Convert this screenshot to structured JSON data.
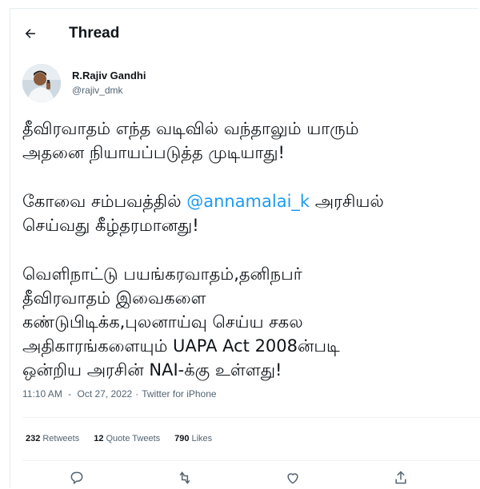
{
  "header": {
    "title": "Thread"
  },
  "tweet": {
    "author": {
      "name": "R.Rajiv Gandhi",
      "handle": "@rajiv_dmk"
    },
    "paragraphs": [
      {
        "lines": [
          {
            "text": "தீவிரவாதம் எந்த வடிவில் வந்தாலும் யாரும்"
          },
          {
            "text": "அதனை நியாயப்படுத்த முடியாது!"
          }
        ]
      },
      {
        "lines": [
          {
            "pre": "கோவை சம்பவத்தில் ",
            "mention": "@annamalai_k",
            "post": " அரசியல்"
          },
          {
            "text": "செய்வது கீழ்தரமானது!"
          }
        ]
      },
      {
        "lines": [
          {
            "text": "வெளிநாட்டு பயங்கரவாதம்,தனிநபர்"
          },
          {
            "text": "தீவிரவாதம் இவைகளை"
          },
          {
            "text": "கண்டுபிடிக்க,புலனாய்வு செய்ய சகல"
          },
          {
            "text": "அதிகாரங்களையும் UAPA Act 2008ன்படி"
          },
          {
            "text": "ஒன்றிய அரசின் NAI-க்கு உள்ளது!"
          }
        ]
      }
    ],
    "meta": {
      "time": "11:10 AM",
      "date": "Oct 27, 2022",
      "separator": "·",
      "source": "Twitter for iPhone"
    },
    "stats": {
      "retweets": {
        "count": "232",
        "label": "Retweets"
      },
      "quotes": {
        "count": "12",
        "label": "Quote Tweets"
      },
      "likes": {
        "count": "790",
        "label": "Likes"
      }
    }
  },
  "colors": {
    "accent": "#1d9bf0",
    "text": "#0f1419",
    "secondary": "#536471",
    "border": "#eff3f4"
  },
  "icons": [
    "back-arrow-icon",
    "reply-icon",
    "retweet-icon",
    "like-icon",
    "share-icon"
  ]
}
